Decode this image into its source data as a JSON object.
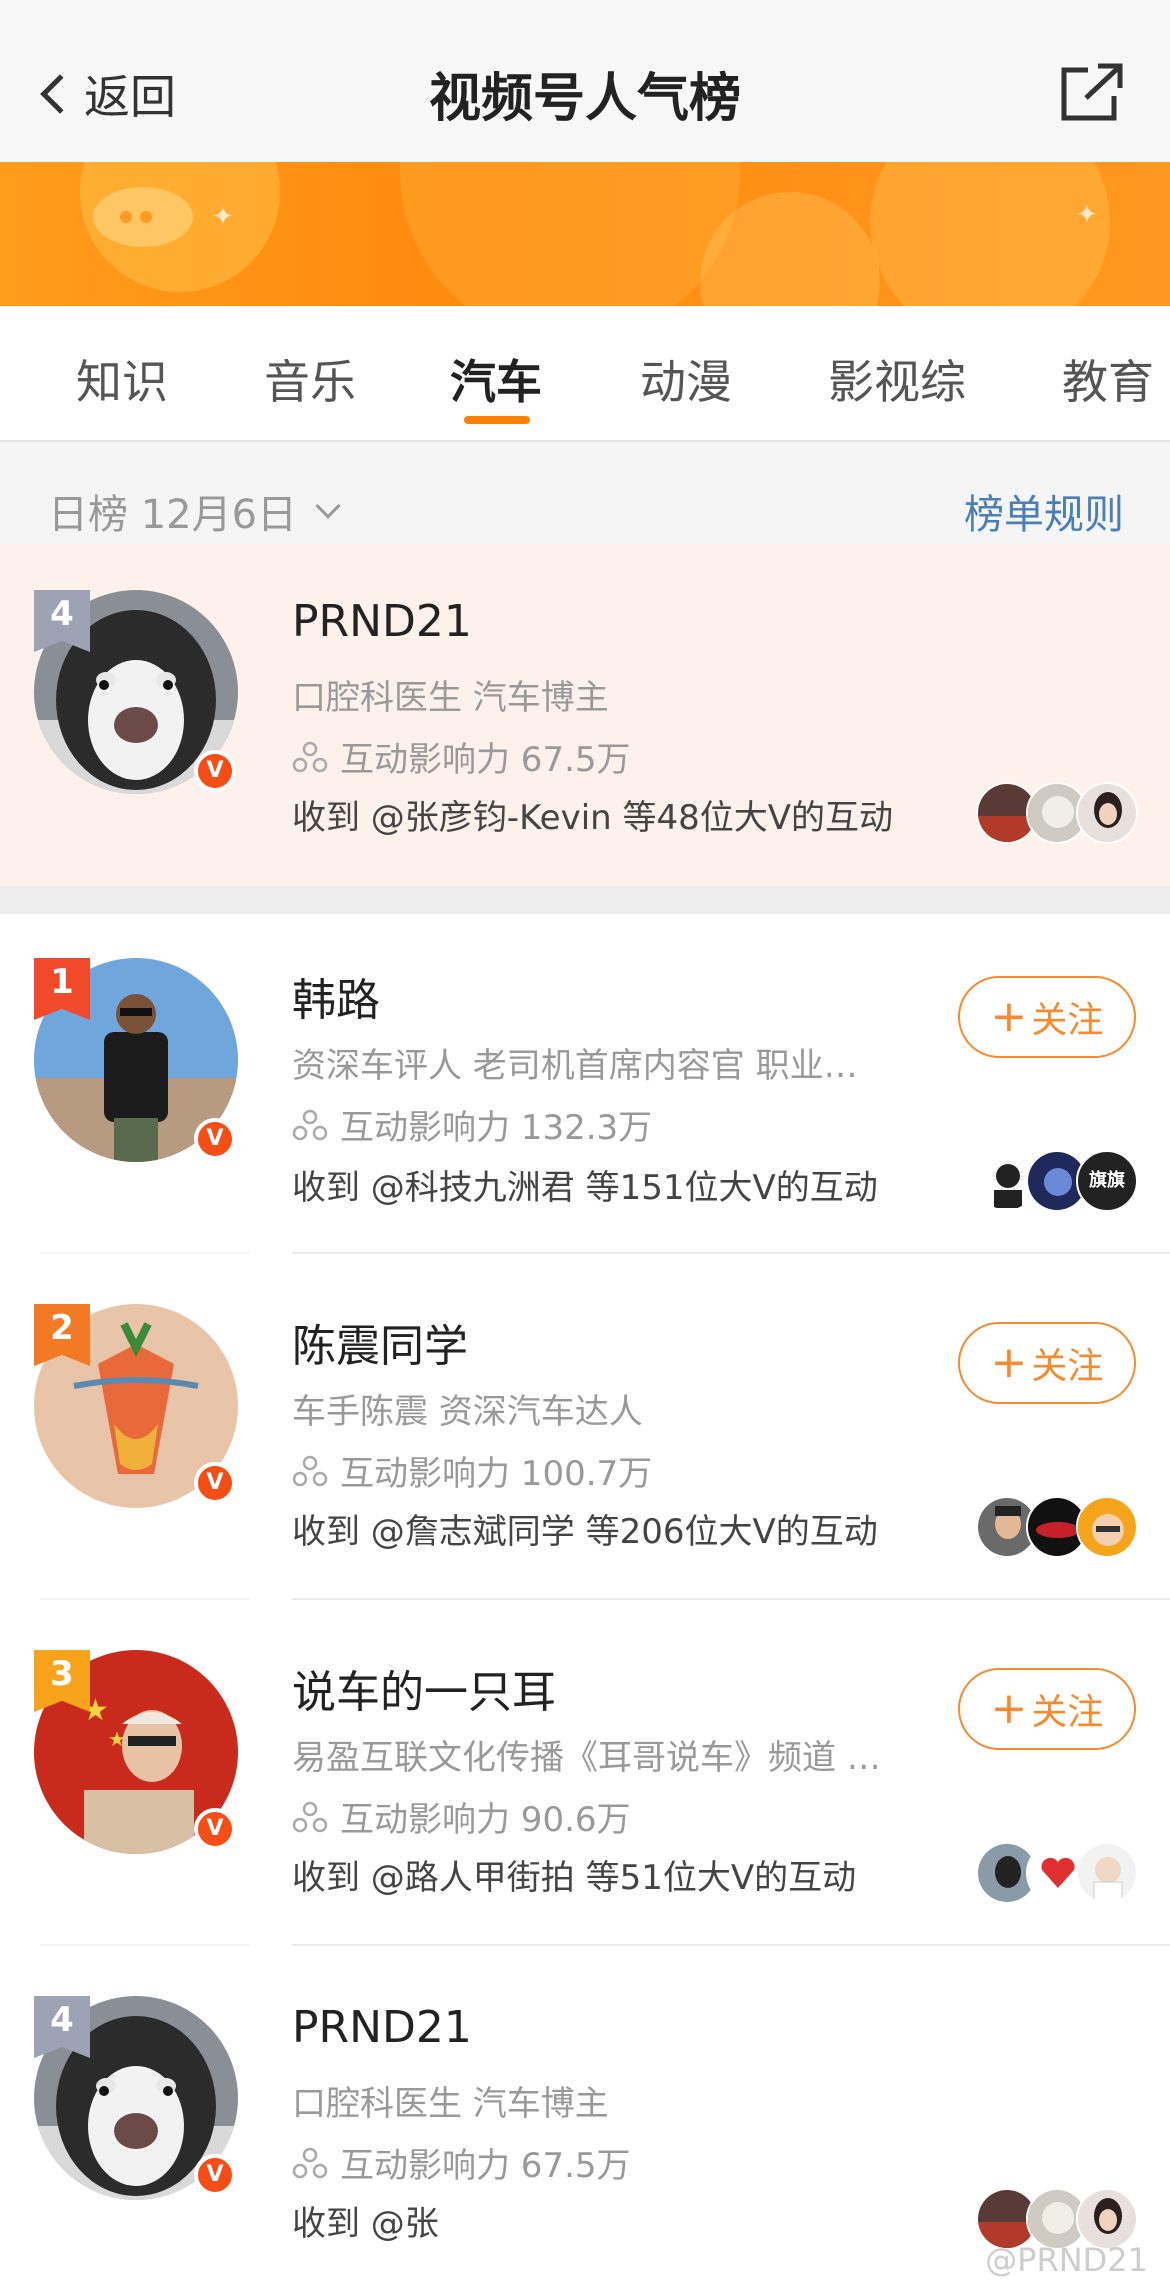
{
  "nav": {
    "back_label": "返回",
    "title": "视频号人气榜"
  },
  "tabs": [
    {
      "label": "知识",
      "active": false
    },
    {
      "label": "音乐",
      "active": false
    },
    {
      "label": "汽车",
      "active": true
    },
    {
      "label": "动漫",
      "active": false
    },
    {
      "label": "影视综",
      "active": false
    },
    {
      "label": "教育",
      "active": false
    }
  ],
  "filter": {
    "date_label": "日榜 12月6日",
    "rules_label": "榜单规则"
  },
  "self_entry": {
    "rank": "4",
    "name": "PRND21",
    "desc": "口腔科医生 汽车博主",
    "influence": "互动影响力 67.5万",
    "interaction": "收到 @张彦钧-Kevin 等48位大V的互动"
  },
  "entries": [
    {
      "rank": "1",
      "name": "韩路",
      "desc": "资深车评人 老司机首席内容官 职业…",
      "influence": "互动影响力 132.3万",
      "interaction": "收到 @科技九洲君 等151位大V的互动",
      "follow_label": "关注",
      "mini_text": "旗旗"
    },
    {
      "rank": "2",
      "name": "陈震同学",
      "desc": "车手陈震 资深汽车达人",
      "influence": "互动影响力 100.7万",
      "interaction": "收到 @詹志斌同学 等206位大V的互动",
      "follow_label": "关注"
    },
    {
      "rank": "3",
      "name": "说车的一只耳",
      "desc": "易盈互联文化传播《耳哥说车》频道 …",
      "influence": "互动影响力 90.6万",
      "interaction": "收到 @路人甲街拍 等51位大V的互动",
      "follow_label": "关注"
    },
    {
      "rank": "4",
      "name": "PRND21",
      "desc": "口腔科医生 汽车博主",
      "influence": "互动影响力 67.5万",
      "interaction": "收到 @张"
    }
  ],
  "verified_badge": "V",
  "watermark": "@PRND21",
  "colors": {
    "accent": "#ff7f00",
    "link": "#4a7eb5",
    "highlight_bg": "#fdf1ec"
  }
}
